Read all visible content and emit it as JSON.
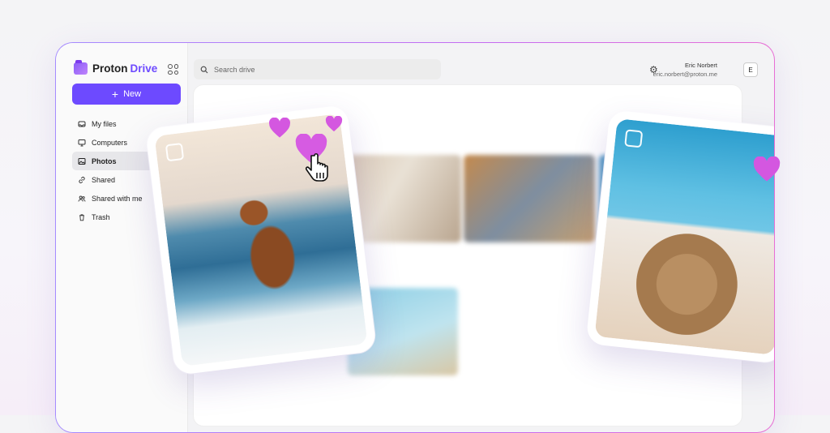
{
  "app": {
    "name_a": "Proton",
    "name_b": "Drive"
  },
  "sidebar": {
    "new_label": "New",
    "items": [
      {
        "label": "My files",
        "icon": "inbox-icon"
      },
      {
        "label": "Computers",
        "icon": "monitor-icon"
      },
      {
        "label": "Photos",
        "icon": "image-icon",
        "active": true
      },
      {
        "label": "Shared",
        "icon": "link-icon"
      },
      {
        "label": "Shared with me",
        "icon": "users-icon"
      },
      {
        "label": "Trash",
        "icon": "trash-icon"
      }
    ]
  },
  "search": {
    "placeholder": "Search drive"
  },
  "user": {
    "name": "Eric Norbert",
    "email": "eric.norbert@proton.me",
    "initial": "E"
  },
  "colors": {
    "accent": "#6d4aff",
    "heart": "#d457e0"
  }
}
